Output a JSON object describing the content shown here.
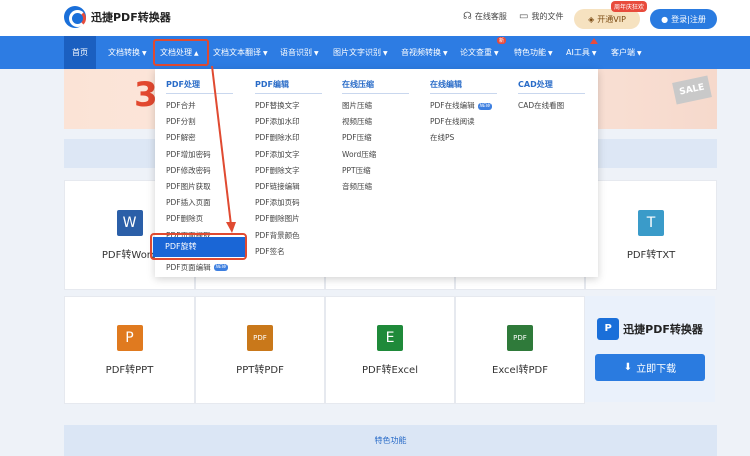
{
  "header": {
    "brand": "迅捷PDF转换器",
    "service": "在线客服",
    "my_files": "我的文件",
    "vip_badge": "周年庆狂欢",
    "vip_label": "开通VIP",
    "login_label": "登录|注册"
  },
  "nav": {
    "items": [
      "首页",
      "文档转换",
      "文档处理",
      "文档文本翻译",
      "语音识别",
      "图片文字识别",
      "音视频转换",
      "论文查重",
      "特色功能",
      "AI工具",
      "客户端"
    ],
    "new_badge": "新"
  },
  "banner": {
    "big_text": "3",
    "sale_text": "SALE"
  },
  "dropdown": {
    "columns": [
      {
        "title": "PDF处理",
        "items": [
          "PDF合并",
          "PDF分割",
          "PDF解密",
          "PDF增加密码",
          "PDF修改密码",
          "PDF图片获取",
          "PDF插入页面",
          "PDF删除页",
          "PDF页面提取",
          "PDF旋转",
          "PDF页面编辑"
        ]
      },
      {
        "title": "PDF编辑",
        "items": [
          "PDF替换文字",
          "PDF添加水印",
          "PDF删除水印",
          "PDF添加文字",
          "PDF删除文字",
          "PDF链接编辑",
          "PDF添加页码",
          "PDF删除图片",
          "PDF背景颜色",
          "PDF签名"
        ]
      },
      {
        "title": "在线压缩",
        "items": [
          "图片压缩",
          "视频压缩",
          "PDF压缩",
          "Word压缩",
          "PPT压缩",
          "音频压缩"
        ]
      },
      {
        "title": "在线编辑",
        "items": [
          "PDF在线编辑",
          "PDF在线阅读",
          "在线PS"
        ]
      },
      {
        "title": "CAD处理",
        "items": [
          "CAD在线看图"
        ]
      }
    ],
    "new_tag": "NEW",
    "selected": "PDF旋转"
  },
  "tools": {
    "row1": [
      {
        "label": "PDF转Word",
        "icon": "W",
        "color": "#2b5fa8"
      },
      {
        "label": "PDF转TXT",
        "icon": "T",
        "color": "#3a9bc9"
      }
    ],
    "row2": [
      {
        "label": "PDF转PPT",
        "icon": "P",
        "color": "#e07a1f"
      },
      {
        "label": "PPT转PDF",
        "icon": "PDF",
        "color": "#c9781a"
      },
      {
        "label": "PDF转Excel",
        "icon": "E",
        "color": "#1f8a3a"
      },
      {
        "label": "Excel转PDF",
        "icon": "PDF",
        "color": "#2f7a3a"
      }
    ]
  },
  "promo": {
    "brand": "迅捷PDF转换器",
    "download": "立即下载"
  },
  "feature_bar": "特色功能"
}
